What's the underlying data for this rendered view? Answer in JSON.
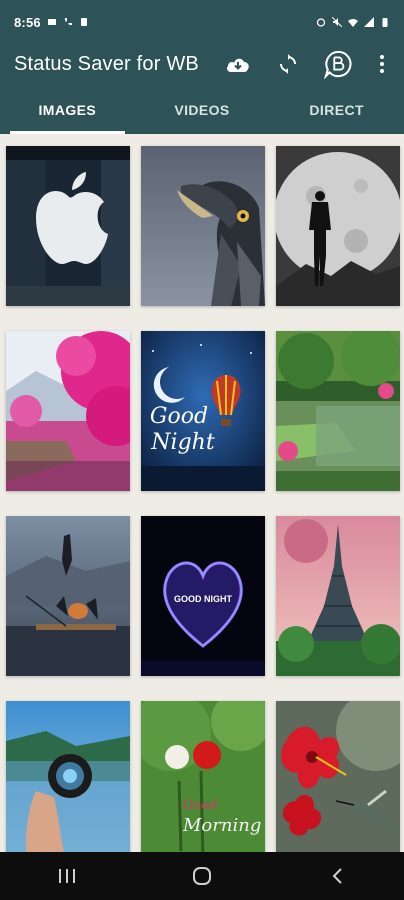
{
  "statusbar": {
    "time": "8:56",
    "icons": [
      "whatsapp-business-icon",
      "phone-icon",
      "sim-icon",
      "alarm-icon",
      "mute-icon",
      "wifi-icon",
      "signal-icon",
      "battery-icon"
    ]
  },
  "appbar": {
    "title": "Status Saver for WB",
    "actions": [
      "download-icon",
      "sync-icon",
      "business-icon",
      "overflow-menu-icon"
    ]
  },
  "tabs": [
    {
      "label": "IMAGES",
      "active": true
    },
    {
      "label": "VIDEOS",
      "active": false
    },
    {
      "label": "DIRECT",
      "active": false
    }
  ],
  "grid": {
    "items": [
      {
        "subject": "apple-logo"
      },
      {
        "subject": "eagle"
      },
      {
        "subject": "moon-silhouette"
      },
      {
        "subject": "pink-trees-lake"
      },
      {
        "subject": "good-night-balloon",
        "text": [
          "Good",
          "Night"
        ]
      },
      {
        "subject": "green-lake-garden"
      },
      {
        "subject": "fisherman-boat"
      },
      {
        "subject": "good-night-heart",
        "text": [
          "GOOD NIGHT"
        ]
      },
      {
        "subject": "eiffel-tower"
      },
      {
        "subject": "hand-lens"
      },
      {
        "subject": "good-morning-roses",
        "text": [
          "Good",
          "Morning"
        ]
      },
      {
        "subject": "hibiscus-hummingbird"
      }
    ]
  },
  "navbar": {
    "buttons": [
      "recent-apps-icon",
      "home-icon",
      "back-icon"
    ]
  },
  "colors": {
    "primary": "#2d5257",
    "background": "#efece6",
    "navbar": "#0d0d0d"
  }
}
